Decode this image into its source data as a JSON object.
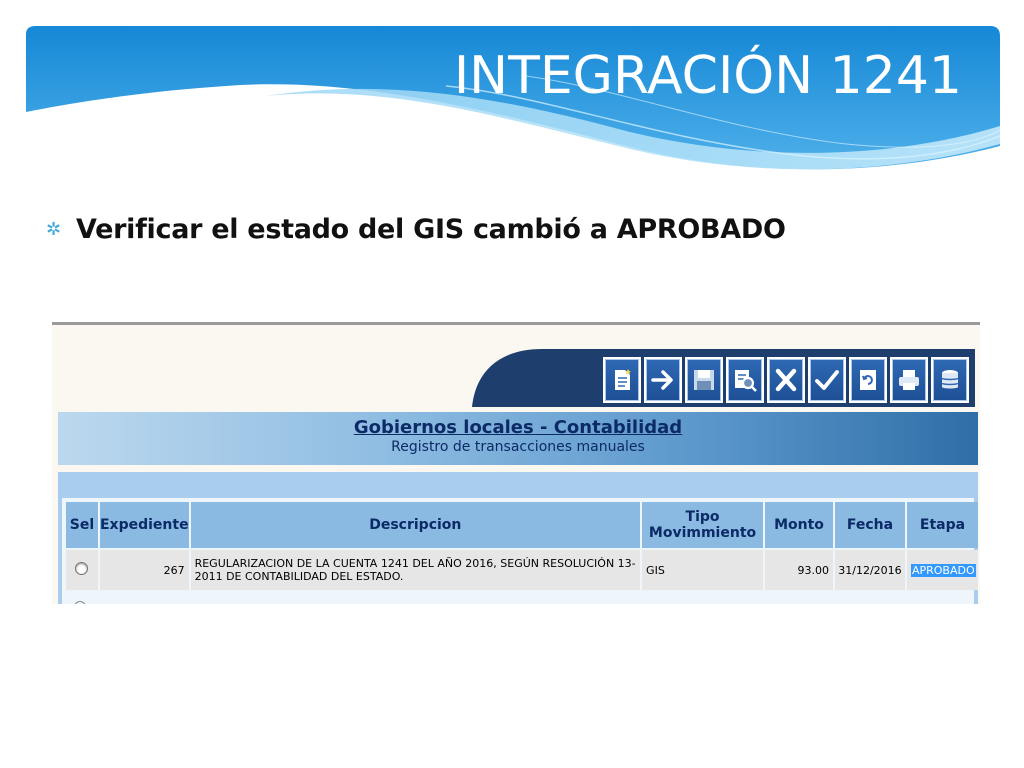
{
  "slide": {
    "title": "INTEGRACIÓN 1241",
    "bullet": "Verificar el estado del GIS cambió a APROBADO",
    "colors": {
      "wave_dark": "#1a8ad4",
      "wave_light": "#7cc7f2",
      "bullet": "#3fa6d8"
    }
  },
  "app": {
    "toolbar": [
      {
        "name": "new-document-icon",
        "glyph": "new"
      },
      {
        "name": "arrow-right-icon",
        "glyph": "arrow"
      },
      {
        "name": "save-icon",
        "glyph": "save"
      },
      {
        "name": "search-document-icon",
        "glyph": "search"
      },
      {
        "name": "close-x-icon",
        "glyph": "x"
      },
      {
        "name": "checkmark-icon",
        "glyph": "check"
      },
      {
        "name": "refresh-document-icon",
        "glyph": "refresh"
      },
      {
        "name": "printer-icon",
        "glyph": "print"
      },
      {
        "name": "database-icon",
        "glyph": "db"
      }
    ],
    "banner": {
      "title": "Gobiernos locales - Contabilidad",
      "subtitle": "Registro de transacciones manuales"
    },
    "table": {
      "headers": {
        "sel": "Sel",
        "expediente": "Expediente",
        "descripcion": "Descripcion",
        "tipo_line1": "Tipo",
        "tipo_line2": "Movimmiento",
        "monto": "Monto",
        "fecha": "Fecha",
        "etapa": "Etapa"
      },
      "rows": [
        {
          "expediente": "267",
          "descripcion_line1": "REGULARIZACION DE LA CUENTA 1241 DEL AÑO 2016, SEGÚN RESOLUCIÓN 13-",
          "descripcion_line2": "2011 DE CONTABILIDAD DEL ESTADO.",
          "tipo": "GIS",
          "monto": "93.00",
          "fecha": "31/12/2016",
          "etapa": "APROBADO"
        }
      ]
    }
  }
}
